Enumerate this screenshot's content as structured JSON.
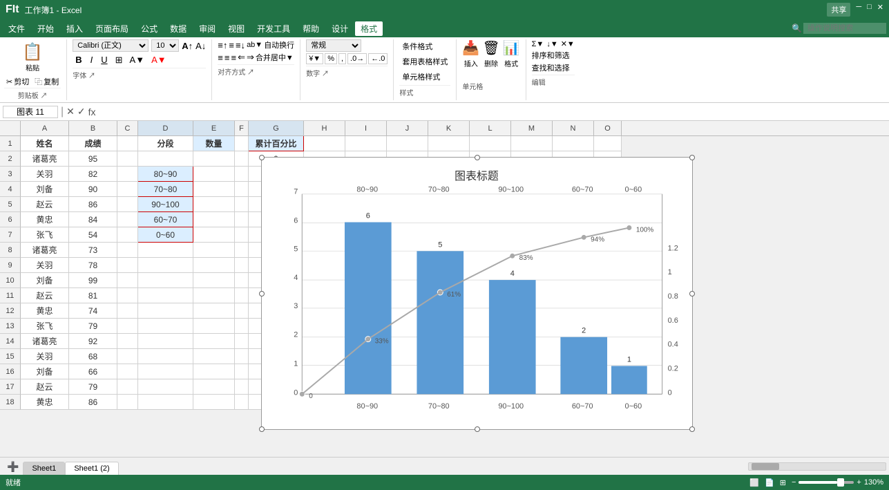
{
  "app": {
    "title": "工作簿1 - Excel",
    "share_label": "共享"
  },
  "menus": [
    "文件",
    "开始",
    "插入",
    "页面布局",
    "公式",
    "数据",
    "审阅",
    "视图",
    "开发工具",
    "帮助",
    "设计",
    "格式"
  ],
  "ribbon": {
    "active_tab": "格式",
    "font_name": "Calibri (正文)",
    "font_size": "10",
    "clipboard_group": "剪贴板",
    "font_group": "字体",
    "alignment_group": "对齐方式",
    "number_group": "数字",
    "styles_group": "样式",
    "cells_group": "单元格",
    "editing_group": "编辑",
    "number_format": "常规",
    "paste_label": "粘贴",
    "cut_label": "剪切",
    "copy_label": "复制",
    "bold_label": "B",
    "italic_label": "I",
    "underline_label": "U",
    "insert_label": "插入",
    "delete_label": "删除",
    "format_label": "格式",
    "conditional_format": "条件格式",
    "table_style": "套用表格样式",
    "cell_style": "单元格样式",
    "sort_filter": "排序和筛选",
    "find_select": "查找和选择",
    "auto_sum": "∑",
    "fill": "↓",
    "clear": "✕",
    "wrap_text": "自动换行",
    "merge_center": "合并居中"
  },
  "formula_bar": {
    "name_box": "图表 11",
    "formula": ""
  },
  "columns": [
    "A",
    "B",
    "C",
    "D",
    "E",
    "F",
    "G",
    "H",
    "I",
    "J",
    "K",
    "L",
    "M",
    "N",
    "O"
  ],
  "rows": [
    1,
    2,
    3,
    4,
    5,
    6,
    7,
    8,
    9,
    10,
    11,
    12,
    13,
    14,
    15,
    16,
    17,
    18
  ],
  "data": {
    "headers": [
      "姓名",
      "成绩",
      "",
      "分段",
      "数量",
      "",
      "累计百分比"
    ],
    "col_d_header": "分段",
    "col_e_header": "数量",
    "col_g_header": "累计百分比",
    "rows": [
      [
        "姓名",
        "成绩",
        "",
        "分段",
        "数量",
        "",
        "累计百分比"
      ],
      [
        "诸葛亮",
        "95",
        "",
        "",
        "",
        "",
        "0"
      ],
      [
        "关羽",
        "82",
        "",
        "80~90",
        "",
        "",
        ""
      ],
      [
        "刘备",
        "90",
        "",
        "70~80",
        "",
        "",
        ""
      ],
      [
        "赵云",
        "86",
        "",
        "90~100",
        "",
        "",
        ""
      ],
      [
        "黄忠",
        "84",
        "",
        "60~70",
        "",
        "",
        ""
      ],
      [
        "张飞",
        "54",
        "",
        "0~60",
        "",
        "",
        ""
      ],
      [
        "诸葛亮",
        "73",
        "",
        "",
        "",
        "",
        ""
      ],
      [
        "关羽",
        "78",
        "",
        "",
        "",
        "",
        ""
      ],
      [
        "刘备",
        "99",
        "",
        "",
        "",
        "",
        ""
      ],
      [
        "赵云",
        "81",
        "",
        "",
        "",
        "",
        ""
      ],
      [
        "黄忠",
        "74",
        "",
        "",
        "",
        "",
        ""
      ],
      [
        "张飞",
        "79",
        "",
        "",
        "",
        "",
        ""
      ],
      [
        "诸葛亮",
        "92",
        "",
        "",
        "",
        "",
        ""
      ],
      [
        "关羽",
        "68",
        "",
        "",
        "",
        "",
        ""
      ],
      [
        "刘备",
        "66",
        "",
        "",
        "",
        "",
        ""
      ],
      [
        "赵云",
        "79",
        "",
        "",
        "",
        "",
        ""
      ],
      [
        "黄忠",
        "86",
        "",
        "",
        "",
        "",
        ""
      ]
    ]
  },
  "chart": {
    "title": "图表标题",
    "x_labels": [
      "80~90",
      "70~80",
      "90~100",
      "60~70",
      "0~60"
    ],
    "bar_values": [
      6,
      5,
      4,
      2,
      1
    ],
    "bar_labels": [
      "6",
      "5",
      "4",
      "2",
      "1"
    ],
    "line_values": [
      0,
      33,
      61,
      83,
      94,
      100
    ],
    "line_labels": [
      "0",
      "33%",
      "61%",
      "83%",
      "94%",
      "100%"
    ],
    "y_left_max": 7,
    "y_right_max": 1.2,
    "y_left_labels": [
      "0",
      "1",
      "2",
      "3",
      "4",
      "5",
      "6",
      "7"
    ],
    "y_right_labels": [
      "0",
      "0.2",
      "0.4",
      "0.6",
      "0.8",
      "1",
      "1.2"
    ],
    "color_bar": "#5B9BD5",
    "color_line": "#A9A9A9"
  },
  "sheets": [
    "Sheet1",
    "Sheet1 (2)"
  ],
  "status": {
    "ready": "就绪",
    "zoom": "130%",
    "view_icons": [
      "普通视图",
      "页面布局视图",
      "分页预览"
    ]
  },
  "search_placeholder": "操作说明搜索"
}
